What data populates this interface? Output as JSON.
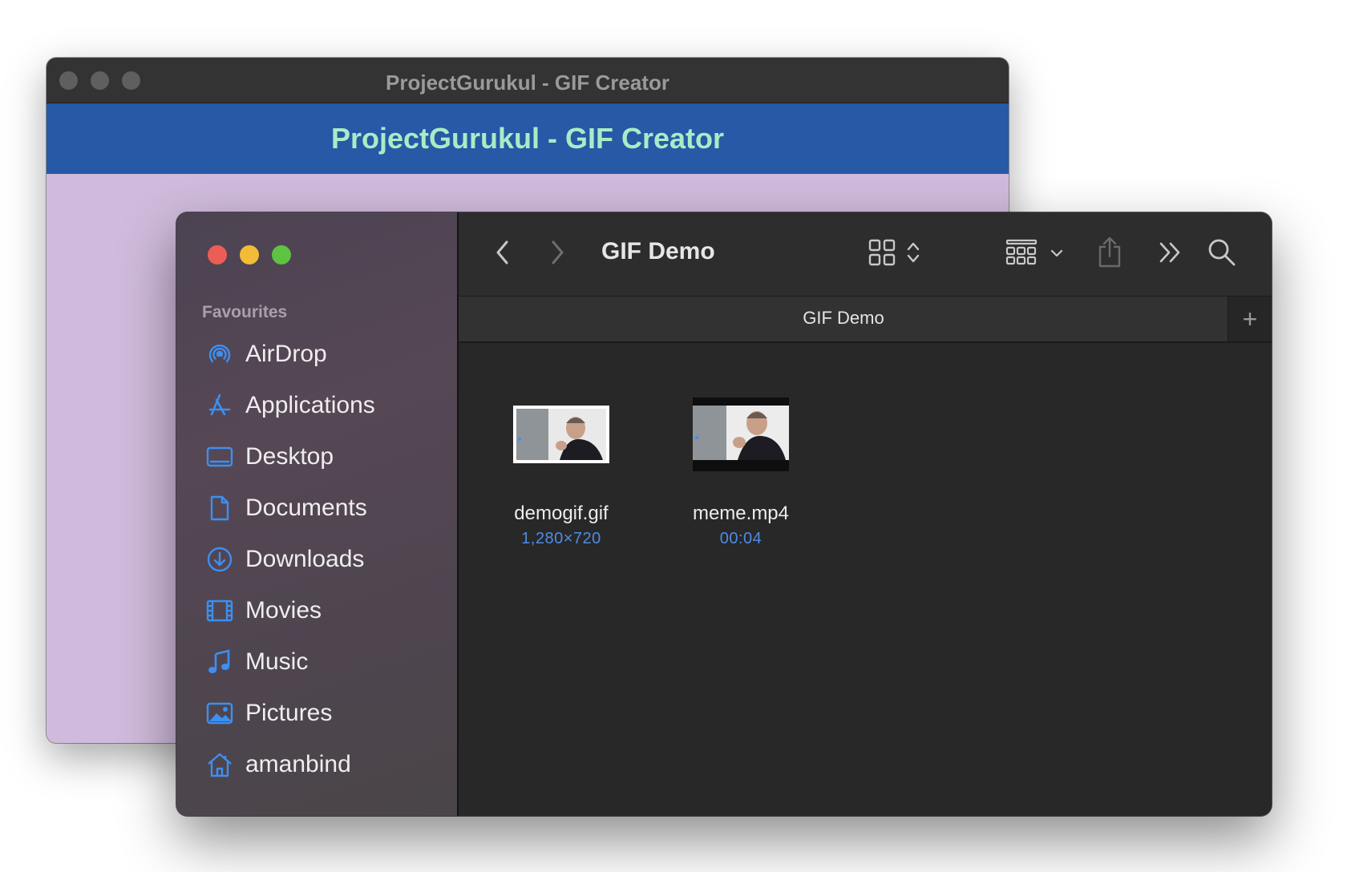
{
  "gif_window": {
    "title": "ProjectGurukul - GIF Creator",
    "banner": "ProjectGurukul - GIF Creator"
  },
  "finder": {
    "sidebar": {
      "heading": "Favourites",
      "items": [
        {
          "label": "AirDrop",
          "icon": "airdrop-icon"
        },
        {
          "label": "Applications",
          "icon": "applications-icon"
        },
        {
          "label": "Desktop",
          "icon": "desktop-icon"
        },
        {
          "label": "Documents",
          "icon": "document-icon"
        },
        {
          "label": "Downloads",
          "icon": "downloads-icon"
        },
        {
          "label": "Movies",
          "icon": "film-icon"
        },
        {
          "label": "Music",
          "icon": "music-note-icon"
        },
        {
          "label": "Pictures",
          "icon": "pictures-icon"
        },
        {
          "label": "amanbind",
          "icon": "home-icon"
        }
      ]
    },
    "toolbar": {
      "title": "GIF Demo"
    },
    "tab": {
      "label": "GIF Demo",
      "add": "+"
    },
    "files": [
      {
        "name": "demogif.gif",
        "meta": "1,280×720"
      },
      {
        "name": "meme.mp4",
        "meta": "00:04"
      }
    ],
    "colors": {
      "accent": "#4d8ce8",
      "sidebar_icon": "#3d8ff0",
      "close": "#ec5e55",
      "minimize": "#f3bc36",
      "zoom": "#5ec243"
    }
  }
}
